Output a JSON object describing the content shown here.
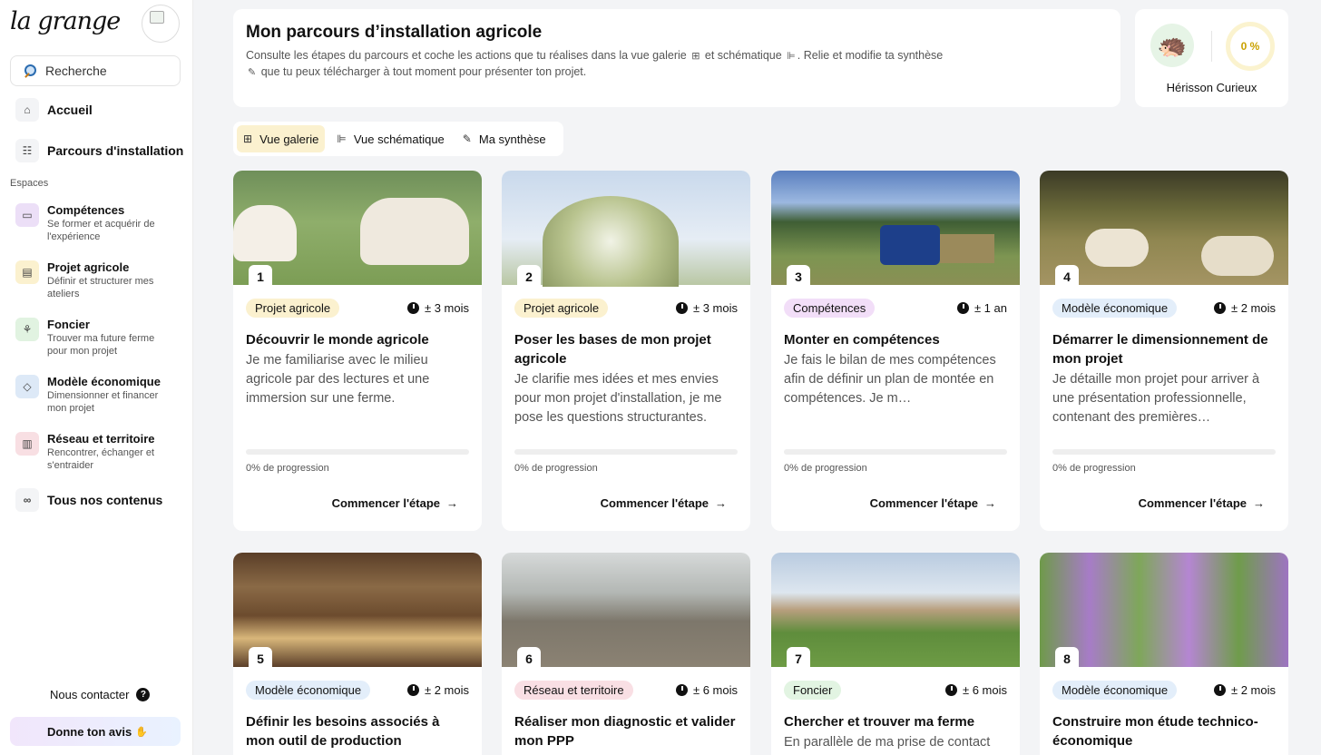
{
  "app": {
    "logo": "la grange"
  },
  "search": {
    "placeholder": "Recherche"
  },
  "nav": [
    {
      "label": "Accueil",
      "icon": "home-icon"
    },
    {
      "label": "Parcours d'installation",
      "icon": "route-icon"
    }
  ],
  "spaces": {
    "section_label": "Espaces",
    "items": [
      {
        "title": "Compétences",
        "subtitle": "Se former et acquérir de l'expérience",
        "icon": "briefcase-icon",
        "color": "#ecdff7"
      },
      {
        "title": "Projet agricole",
        "subtitle": "Définir et structurer mes ateliers",
        "icon": "folder-icon",
        "color": "#fbf1cf"
      },
      {
        "title": "Foncier",
        "subtitle": "Trouver ma future ferme pour mon projet",
        "icon": "sprout-icon",
        "color": "#e1f3e1"
      },
      {
        "title": "Modèle économique",
        "subtitle": "Dimensionner et financer mon projet",
        "icon": "tag-icon",
        "color": "#dde9f7"
      },
      {
        "title": "Réseau et territoire",
        "subtitle": "Rencontrer, échanger et s'entraider",
        "icon": "book-icon",
        "color": "#f8dfe3"
      }
    ],
    "all_contents": "Tous nos contenus"
  },
  "footer": {
    "contact": "Nous contacter",
    "feedback": "Donne ton avis"
  },
  "header": {
    "title": "Mon parcours d’installation agricole",
    "desc_part1": "Consulte les étapes du parcours et coche les actions que tu réalises dans la vue galerie",
    "desc_part2": "et schématique",
    "desc_part3": ". Relie et modifie ta synthèse",
    "desc_part4": "que tu peux télécharger à tout moment pour présenter ton projet."
  },
  "profile": {
    "name": "Hérisson Curieux",
    "progress": "0 %"
  },
  "tabs": [
    {
      "label": "Vue galerie",
      "active": true,
      "icon": "grid-icon"
    },
    {
      "label": "Vue schématique",
      "active": false,
      "icon": "diagram-icon"
    },
    {
      "label": "Ma synthèse",
      "active": false,
      "icon": "edit-icon"
    }
  ],
  "common": {
    "start": "Commencer l'étape",
    "progress_suffix": "0% de progression"
  },
  "steps": [
    {
      "num": "1",
      "tag": "Projet agricole",
      "tag_color": "#fbf1cf",
      "duration": "± 3 mois",
      "title": "Découvrir le monde agricole",
      "desc": "Je me familiarise avec le milieu agricole par des lectures et une immersion sur une ferme.",
      "progress": 0
    },
    {
      "num": "2",
      "tag": "Projet agricole",
      "tag_color": "#fbf1cf",
      "duration": "± 3 mois",
      "title": "Poser les bases de mon projet agricole",
      "desc": "Je clarifie mes idées et mes envies pour mon projet d'installation, je me pose les questions structurantes.",
      "progress": 0
    },
    {
      "num": "3",
      "tag": "Compétences",
      "tag_color": "#f2def8",
      "duration": "± 1 an",
      "title": "Monter en compétences",
      "desc": "Je fais le bilan de mes compétences afin de définir un plan de montée en compétences. Je m…",
      "progress": 0
    },
    {
      "num": "4",
      "tag": "Modèle économique",
      "tag_color": "#e3eefa",
      "duration": "± 2 mois",
      "title": "Démarrer le dimensionnement de mon projet",
      "desc": "Je détaille mon projet pour arriver à une présentation professionnelle, contenant des premières…",
      "progress": 0
    },
    {
      "num": "5",
      "tag": "Modèle économique",
      "tag_color": "#e3eefa",
      "duration": "± 2 mois",
      "title": "Définir les besoins associés à mon outil de production",
      "desc": ""
    },
    {
      "num": "6",
      "tag": "Réseau et territoire",
      "tag_color": "#f9dfe4",
      "duration": "± 6 mois",
      "title": "Réaliser mon diagnostic et valider mon PPP",
      "desc": ""
    },
    {
      "num": "7",
      "tag": "Foncier",
      "tag_color": "#e2f4e2",
      "duration": "± 6 mois",
      "title": "Chercher et trouver ma ferme",
      "desc": "En parallèle de ma prise de contact"
    },
    {
      "num": "8",
      "tag": "Modèle économique",
      "tag_color": "#e3eefa",
      "duration": "± 2 mois",
      "title": "Construire mon étude technico-économique",
      "desc": ""
    }
  ]
}
